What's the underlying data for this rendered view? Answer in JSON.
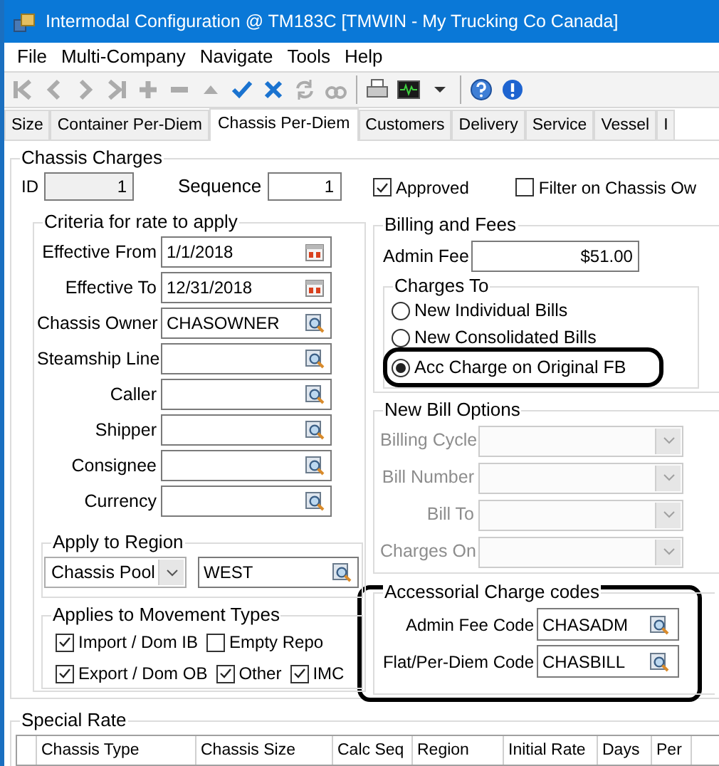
{
  "window": {
    "title": "Intermodal Configuration @ TM183C [TMWIN - My Trucking Co Canada]"
  },
  "menu": [
    "File",
    "Multi-Company",
    "Navigate",
    "Tools",
    "Help"
  ],
  "toolbar": [
    [
      {
        "kind": "first",
        "disabled": true
      },
      {
        "kind": "previous",
        "disabled": true
      },
      {
        "kind": "next",
        "disabled": true
      },
      {
        "kind": "last",
        "disabled": true
      },
      {
        "kind": "add",
        "disabled": true
      },
      {
        "kind": "remove",
        "disabled": true
      },
      {
        "kind": "up",
        "disabled": true
      },
      {
        "kind": "save",
        "disabled": false
      },
      {
        "kind": "cancel",
        "disabled": false
      },
      {
        "kind": "refresh",
        "disabled": true
      },
      {
        "kind": "find",
        "disabled": true
      }
    ],
    [
      {
        "kind": "print",
        "disabled": false
      },
      {
        "kind": "monitor",
        "disabled": false
      },
      {
        "kind": "dropdown",
        "disabled": false
      }
    ],
    [
      {
        "kind": "help",
        "disabled": false
      },
      {
        "kind": "info",
        "disabled": false
      }
    ]
  ],
  "tabs": [
    {
      "label": "Size",
      "selected": false
    },
    {
      "label": "Container Per-Diem",
      "selected": false
    },
    {
      "label": "Chassis Per-Diem",
      "selected": true
    },
    {
      "label": "Customers",
      "selected": false
    },
    {
      "label": "Delivery",
      "selected": false
    },
    {
      "label": "Service",
      "selected": false
    },
    {
      "label": "Vessel",
      "selected": false
    },
    {
      "label": "I",
      "selected": false
    }
  ],
  "chassis_charges": {
    "title": "Chassis Charges",
    "id": {
      "label": "ID",
      "value": "1"
    },
    "sequence": {
      "label": "Sequence",
      "value": "1"
    },
    "checks": [
      {
        "label": "Approved",
        "checked": true
      },
      {
        "label": "Filter on Chassis Ow",
        "checked": false
      }
    ]
  },
  "criteria": {
    "title": "Criteria for rate to apply",
    "fields": [
      {
        "label": "Effective From",
        "value": "1/1/2018",
        "kind": "date"
      },
      {
        "label": "Effective To",
        "value": "12/31/2018",
        "kind": "date"
      },
      {
        "label": "Chassis Owner",
        "value": "CHASOWNER",
        "kind": "lookup"
      },
      {
        "label": "Steamship Line",
        "kind": "lookup"
      },
      {
        "label": "Caller",
        "kind": "lookup"
      },
      {
        "label": "Shipper",
        "kind": "lookup"
      },
      {
        "label": "Consignee",
        "kind": "lookup"
      },
      {
        "label": "Currency",
        "kind": "lookup"
      }
    ]
  },
  "region": {
    "title": "Apply to Region",
    "type": "Chassis Pool",
    "value": "WEST"
  },
  "movement_types": {
    "title": "Applies to Movement Types",
    "rows": [
      [
        {
          "label": "Import / Dom IB",
          "checked": true
        },
        {
          "label": "Empty Repo",
          "checked": false
        }
      ],
      [
        {
          "label": "Export / Dom OB",
          "checked": true
        },
        {
          "label": "Other",
          "checked": true
        },
        {
          "label": "IMC",
          "checked": true
        }
      ]
    ]
  },
  "billing": {
    "title": "Billing and Fees",
    "admin_fee": {
      "label": "Admin Fee",
      "value": "$51.00"
    },
    "charges_to": {
      "title": "Charges To",
      "options": [
        {
          "label": "New Individual Bills",
          "selected": false,
          "highlighted": false
        },
        {
          "label": "New Consolidated Bills",
          "selected": false,
          "highlighted": false
        },
        {
          "label": "Acc Charge on Original FB",
          "selected": true,
          "highlighted": true
        }
      ]
    }
  },
  "new_bill_options": {
    "title": "New Bill Options",
    "disabled": true,
    "fields": [
      "Billing Cycle",
      "Bill Number",
      "Bill To",
      "Charges On"
    ]
  },
  "accessorial": {
    "title": "Accessorial Charge codes",
    "highlighted": true,
    "fields": [
      {
        "label": "Admin Fee Code",
        "value": "CHASADM"
      },
      {
        "label": "Flat/Per-Diem Code",
        "value": "CHASBILL"
      }
    ]
  },
  "special_rate": {
    "title": "Special Rate",
    "columns": [
      "Chassis Type",
      "Chassis Size",
      "Calc Seq",
      "Region",
      "Initial Rate",
      "Days",
      "Per"
    ]
  }
}
